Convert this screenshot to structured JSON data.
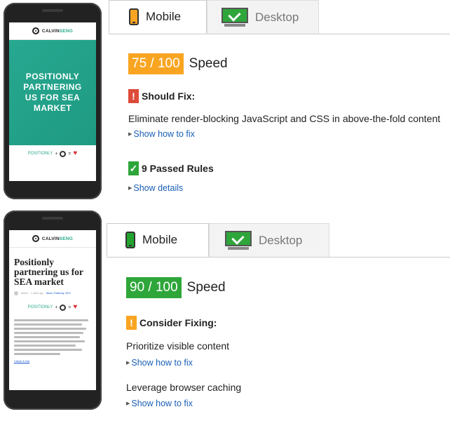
{
  "phone_top": {
    "logo_text_a": "CALVIN",
    "logo_text_b": "SENG",
    "hero_title": "POSITIONLY\nPARTNERING\nUS FOR SEA\nMARKET",
    "partner_label": "POSITIONLY"
  },
  "phone_bottom": {
    "logo_text_a": "CALVIN",
    "logo_text_b": "SENG",
    "article_title": "Positionly\npartnering us for\nSEA market",
    "meta_author": "Admin",
    "meta_time": "1 week ago",
    "meta_tags": "News, Positionly, SEO",
    "partner_label": "POSITIONLY",
    "body_link": "Check It Out"
  },
  "top": {
    "tabs": [
      {
        "label": "Mobile",
        "active": true
      },
      {
        "label": "Desktop",
        "active": false
      }
    ],
    "score": "75 / 100",
    "score_label": "Speed",
    "should_fix_title": "Should Fix:",
    "should_fix_icon": "!",
    "rule_1": "Eliminate render-blocking JavaScript and CSS in above-the-fold content",
    "show_how": "Show how to fix",
    "passed_title": "9 Passed Rules",
    "passed_icon": "✓",
    "show_details": "Show details"
  },
  "bottom": {
    "tabs": [
      {
        "label": "Mobile",
        "active": true
      },
      {
        "label": "Desktop",
        "active": false
      }
    ],
    "score": "90 / 100",
    "score_label": "Speed",
    "consider_title": "Consider Fixing:",
    "consider_icon": "!",
    "rule_1": "Prioritize visible content",
    "show_how_1": "Show how to fix",
    "rule_2": "Leverage browser caching",
    "show_how_2": "Show how to fix"
  },
  "colors": {
    "orange": "#f9a521",
    "green": "#2ea63a",
    "red": "#dd4b39",
    "teal": "#27a890",
    "link": "#1a5fb4"
  },
  "icons": [
    "mobile-phone-icon",
    "desktop-monitor-icon",
    "checkmark-icon",
    "exclamation-icon",
    "triangle-right-icon",
    "heart-icon"
  ]
}
